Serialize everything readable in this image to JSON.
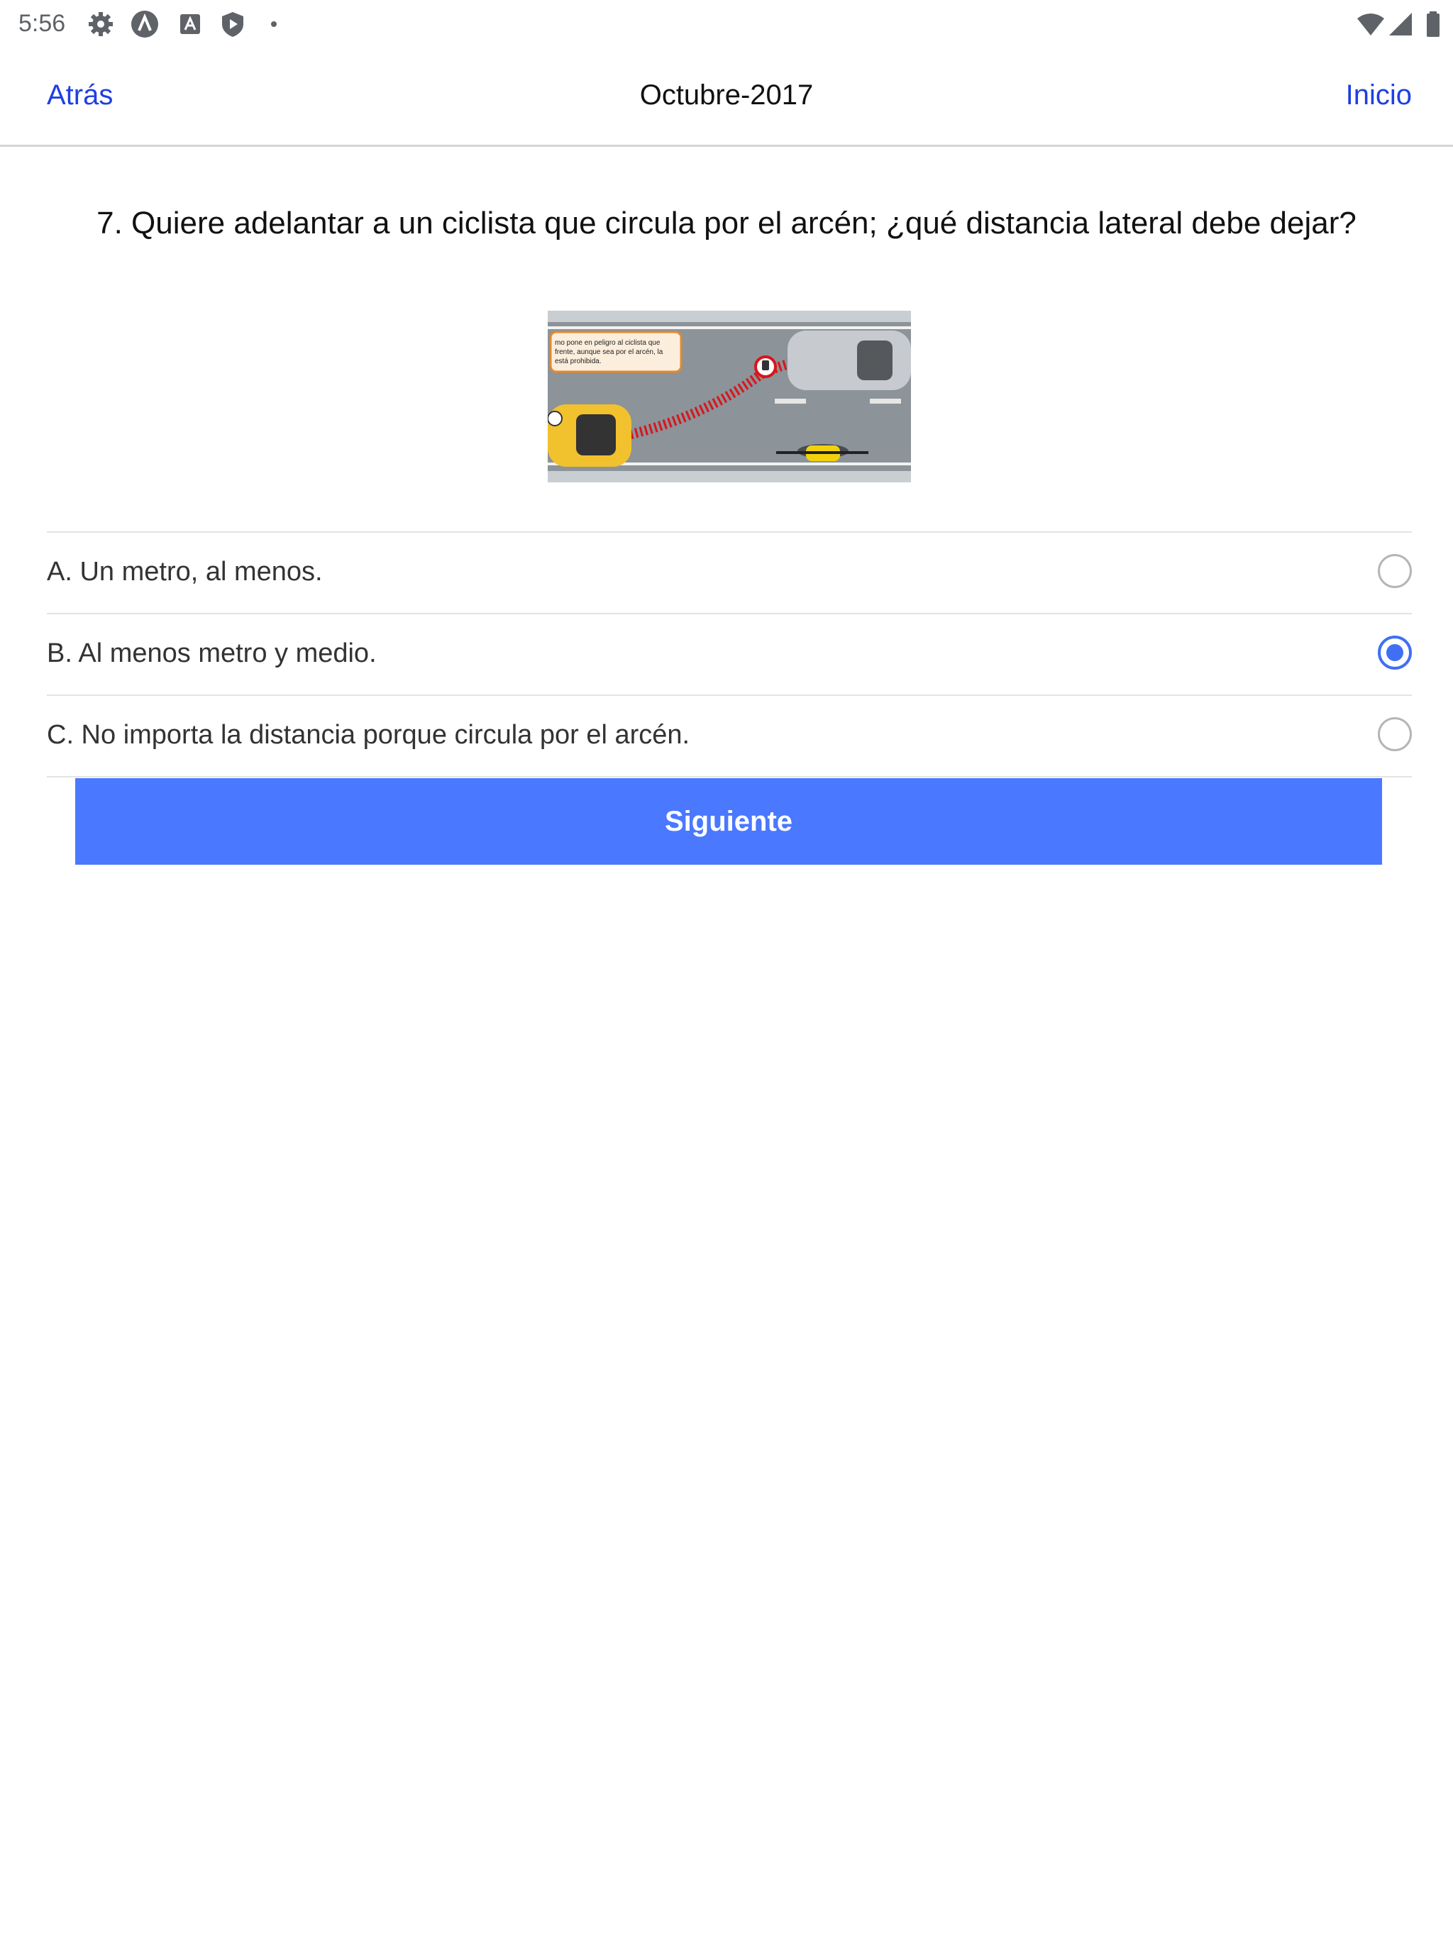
{
  "status_bar": {
    "time": "5:56",
    "icons": [
      "gear-icon",
      "a-circle-icon",
      "a-square-icon",
      "shield-play-icon",
      "dot-icon",
      "wifi-icon",
      "signal-icon",
      "battery-icon"
    ]
  },
  "nav": {
    "back_label": "Atrás",
    "title": "Octubre-2017",
    "home_label": "Inicio"
  },
  "question": {
    "text": "7. Quiere adelantar a un ciclista que circula por el arcén; ¿qué distancia lateral debe dejar?",
    "image_caption": "mo pone en peligro al ciclista que frente, aunque sea por el arcén, la está prohibida."
  },
  "options": [
    {
      "label": "A. Un metro, al menos.",
      "selected": false
    },
    {
      "label": "B. Al menos metro y medio.",
      "selected": true
    },
    {
      "label": "C. No importa la distancia porque circula por el arcén.",
      "selected": false
    }
  ],
  "next_button": {
    "label": "Siguiente"
  },
  "colors": {
    "link": "#1f3fe0",
    "accent": "#4a78ff",
    "radio_selected": "#3f6ff4"
  }
}
